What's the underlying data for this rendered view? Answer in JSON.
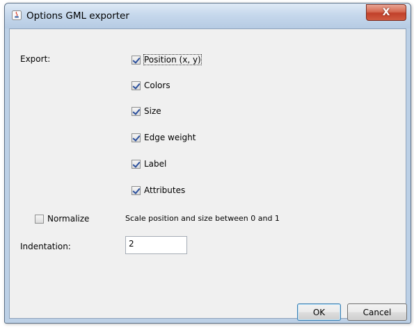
{
  "window": {
    "title": "Options GML exporter",
    "close_label": "X",
    "app_icon": "java-coffee-icon"
  },
  "export": {
    "label": "Export:",
    "options": [
      {
        "label": "Position (x, y)",
        "checked": true
      },
      {
        "label": "Colors",
        "checked": true
      },
      {
        "label": "Size",
        "checked": true
      },
      {
        "label": "Edge weight",
        "checked": true
      },
      {
        "label": "Label",
        "checked": true
      },
      {
        "label": "Attributes",
        "checked": true
      }
    ]
  },
  "normalize": {
    "label": "Normalize",
    "checked": false,
    "description": "Scale position and size between 0 and 1"
  },
  "indentation": {
    "label": "Indentation:",
    "value": "2"
  },
  "buttons": {
    "ok": "OK",
    "cancel": "Cancel"
  }
}
